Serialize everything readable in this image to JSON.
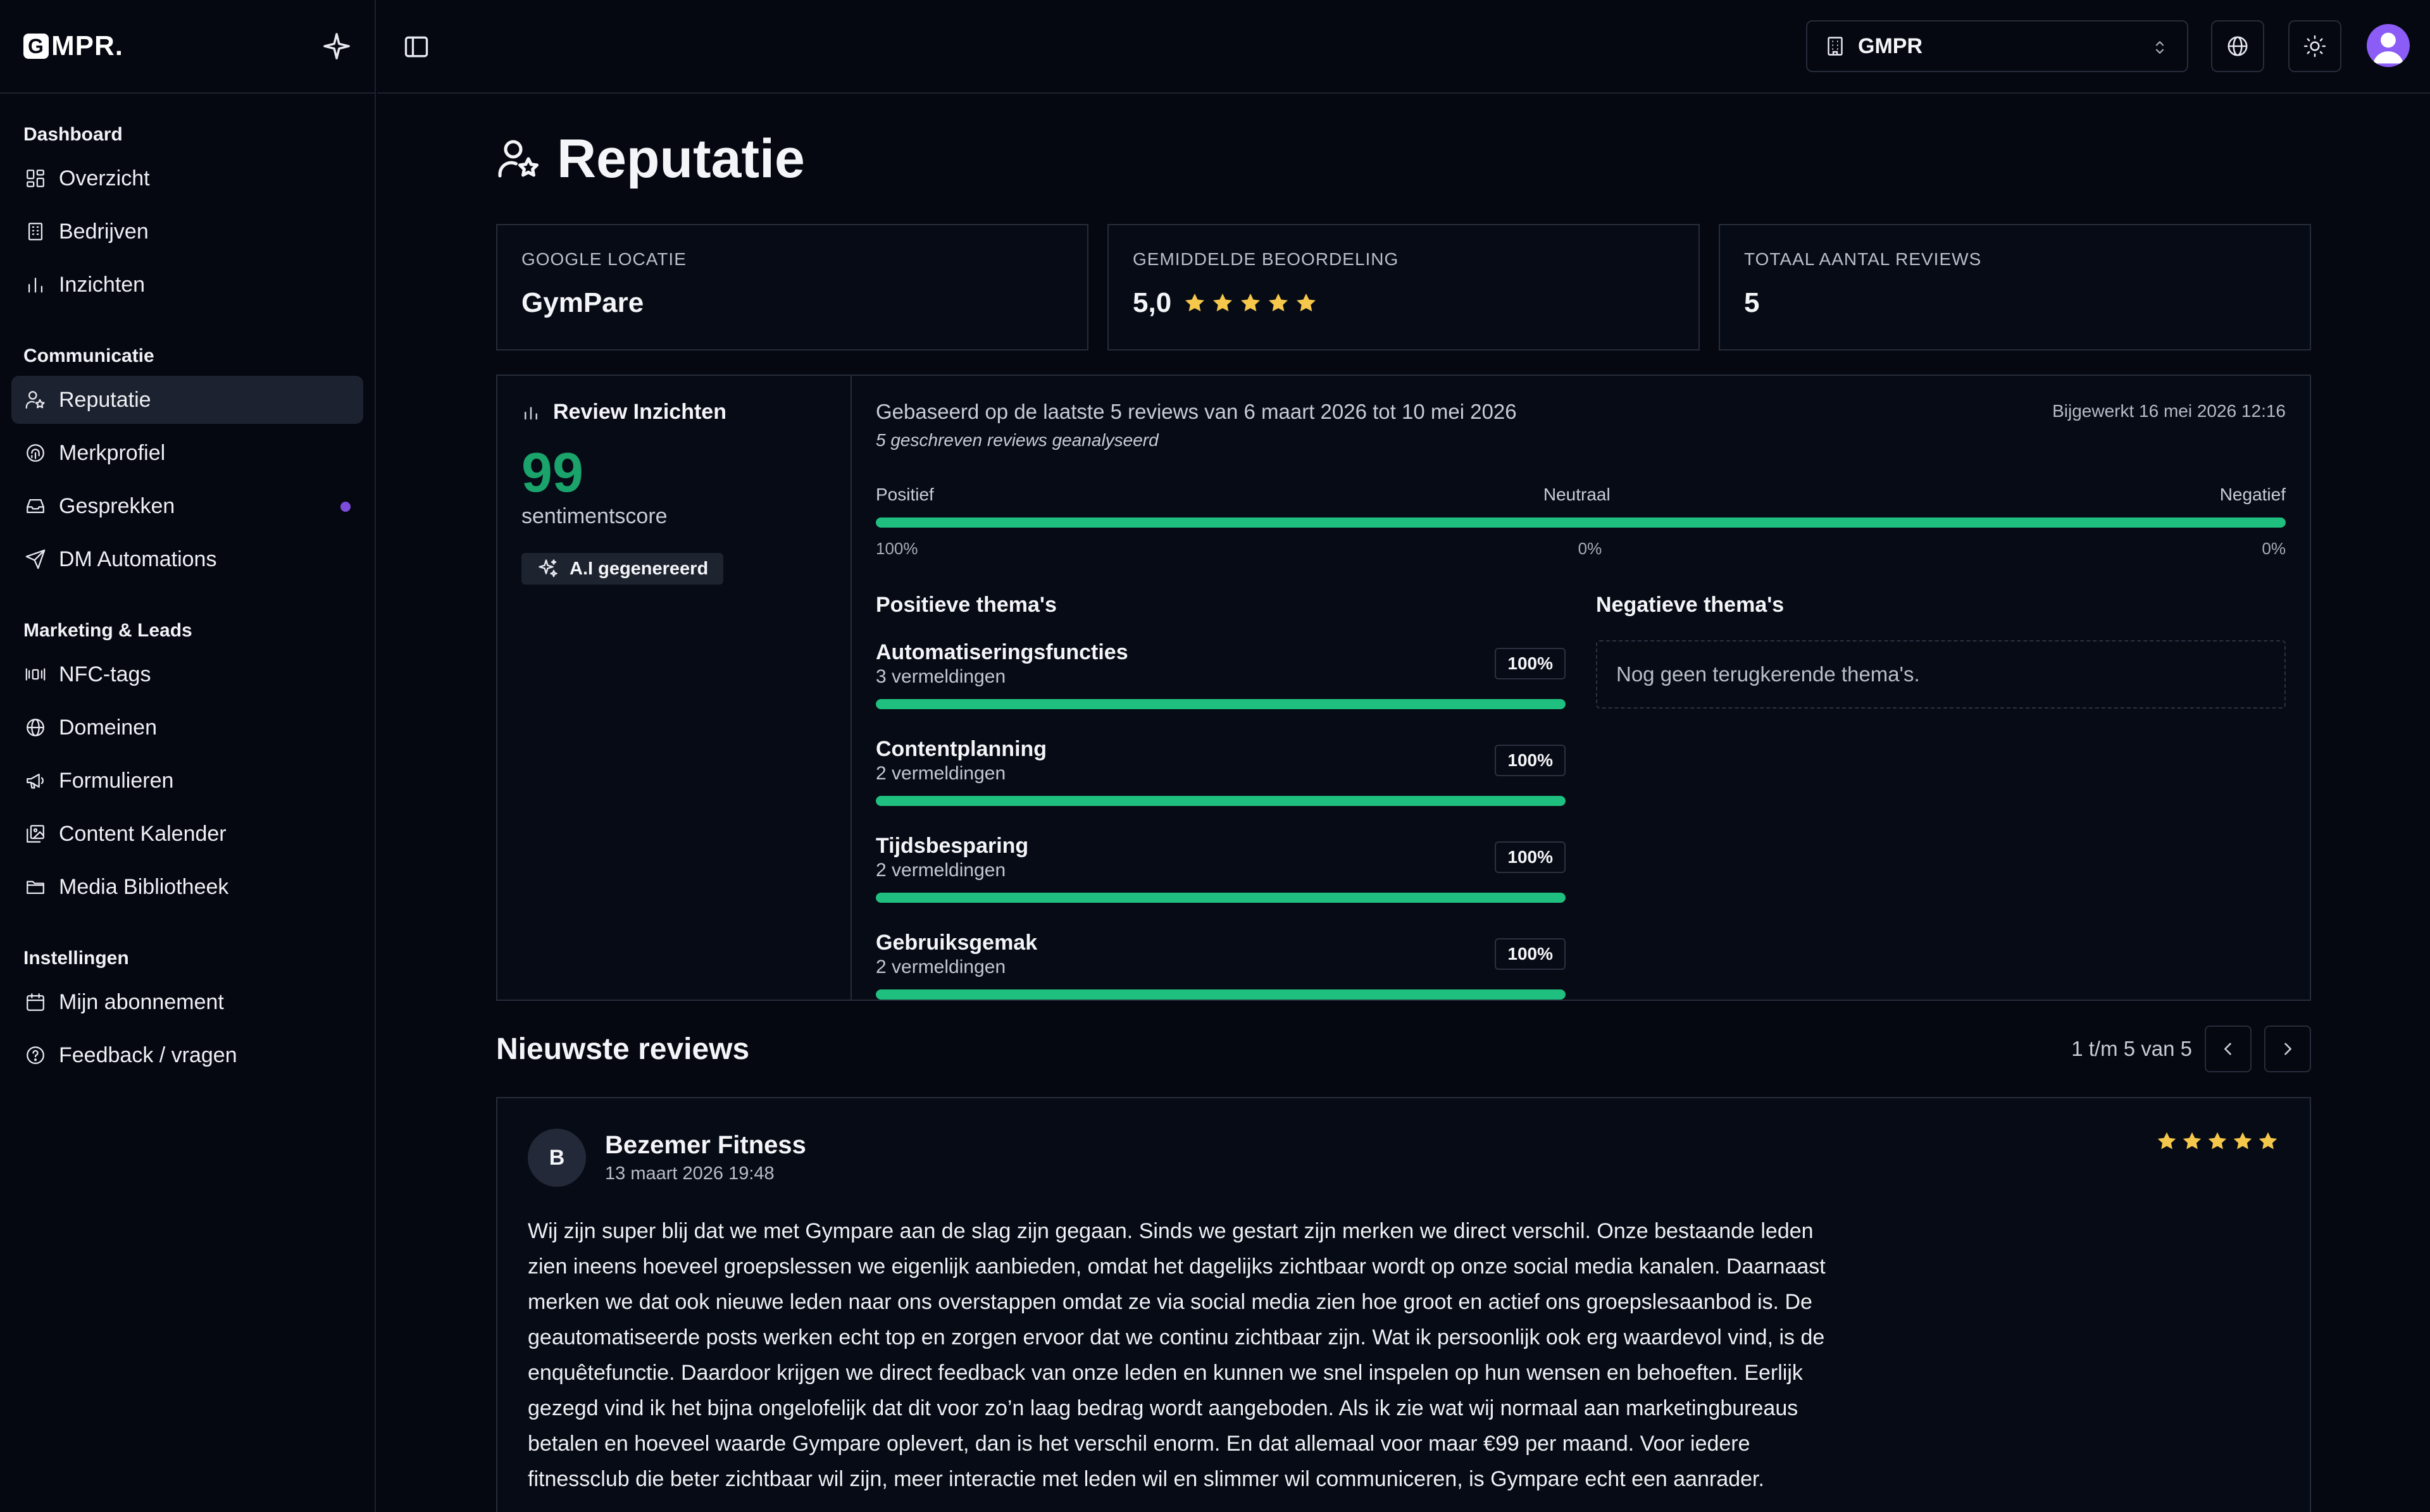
{
  "brand": {
    "name": "MPR.",
    "mark": "G"
  },
  "sidebar": {
    "sections": [
      {
        "title": "Dashboard",
        "items": [
          {
            "label": "Overzicht",
            "icon": "grid-icon"
          },
          {
            "label": "Bedrijven",
            "icon": "building-icon"
          },
          {
            "label": "Inzichten",
            "icon": "bar-chart-icon"
          }
        ]
      },
      {
        "title": "Communicatie",
        "items": [
          {
            "label": "Reputatie",
            "icon": "user-star-icon",
            "active": true
          },
          {
            "label": "Merkprofiel",
            "icon": "fingerprint-icon"
          },
          {
            "label": "Gesprekken",
            "icon": "inbox-icon",
            "badge": true
          },
          {
            "label": "DM Automations",
            "icon": "send-icon"
          }
        ]
      },
      {
        "title": "Marketing & Leads",
        "items": [
          {
            "label": "NFC-tags",
            "icon": "nfc-icon"
          },
          {
            "label": "Domeinen",
            "icon": "globe-icon"
          },
          {
            "label": "Formulieren",
            "icon": "megaphone-icon"
          },
          {
            "label": "Content Kalender",
            "icon": "images-icon"
          },
          {
            "label": "Media Bibliotheek",
            "icon": "folder-icon"
          }
        ]
      },
      {
        "title": "Instellingen",
        "items": [
          {
            "label": "Mijn abonnement",
            "icon": "calendar-icon"
          },
          {
            "label": "Feedback / vragen",
            "icon": "help-circle-icon"
          }
        ]
      }
    ]
  },
  "topbar": {
    "org": "GMPR"
  },
  "page": {
    "title": "Reputatie"
  },
  "stats": {
    "location_label": "GOOGLE LOCATIE",
    "location_value": "GymPare",
    "rating_label": "GEMIDDELDE BEOORDELING",
    "rating_value": "5,0",
    "rating_stars": 5,
    "total_label": "TOTAAL AANTAL REVIEWS",
    "total_value": "5"
  },
  "insights": {
    "title": "Review Inzichten",
    "score": "99",
    "score_label": "sentimentscore",
    "ai_badge": "A.I gegenereerd",
    "based_on": "Gebaseerd op de laatste 5 reviews van 6 maart 2026 tot 10 mei 2026",
    "analyzed": "5 geschreven reviews geanalyseerd",
    "updated": "Bijgewerkt 16 mei 2026 12:16",
    "positive_label": "Positief",
    "neutral_label": "Neutraal",
    "negative_label": "Negatief",
    "positive_pct": "100%",
    "neutral_pct": "0%",
    "negative_pct": "0%",
    "positive_fraction": 1.0,
    "positive_themes_title": "Positieve thema's",
    "negative_themes_title": "Negatieve thema's",
    "positive_themes": [
      {
        "name": "Automatiseringsfuncties",
        "count": "3 vermeldingen",
        "pct": "100%",
        "fraction": 1.0
      },
      {
        "name": "Contentplanning",
        "count": "2 vermeldingen",
        "pct": "100%",
        "fraction": 1.0
      },
      {
        "name": "Tijdsbesparing",
        "count": "2 vermeldingen",
        "pct": "100%",
        "fraction": 1.0
      },
      {
        "name": "Gebruiksgemak",
        "count": "2 vermeldingen",
        "pct": "100%",
        "fraction": 1.0
      }
    ],
    "negative_empty": "Nog geen terugkerende thema's."
  },
  "reviews": {
    "title": "Nieuwste reviews",
    "pagination": "1 t/m 5 van 5",
    "items": [
      {
        "initial": "B",
        "name": "Bezemer Fitness",
        "date": "13 maart 2026 19:48",
        "stars": 5,
        "text": "Wij zijn super blij dat we met Gympare aan de slag zijn gegaan. Sinds we gestart zijn merken we direct verschil. Onze bestaande leden zien ineens hoeveel groepslessen we eigenlijk aanbieden, omdat het dagelijks zichtbaar wordt op onze social media kanalen. Daarnaast merken we dat ook nieuwe leden naar ons overstappen omdat ze via social media zien hoe groot en actief ons groepslesaanbod is. De geautomatiseerde posts werken echt top en zorgen ervoor dat we continu zichtbaar zijn. Wat ik persoonlijk ook erg waardevol vind, is de enquêtefunctie. Daardoor krijgen we direct feedback van onze leden en kunnen we snel inspelen op hun wensen en behoeften. Eerlijk gezegd vind ik het bijna ongelofelijk dat dit voor zo’n laag bedrag wordt aangeboden. Als ik zie wat wij normaal aan marketingbureaus betalen en hoeveel waarde Gympare oplevert, dan is het verschil enorm. En dat allemaal voor maar €99 per maand. Voor iedere fitnessclub die beter zichtbaar wil zijn, meer interactie met leden wil en slimmer wil communiceren, is Gympare echt een aanrader."
      }
    ]
  },
  "colors": {
    "accent": "#1fbf7f",
    "score": "#1aa36b",
    "star": "#f5c84b",
    "badge": "#7c4ddb",
    "avatar": "#8b5cf6"
  }
}
